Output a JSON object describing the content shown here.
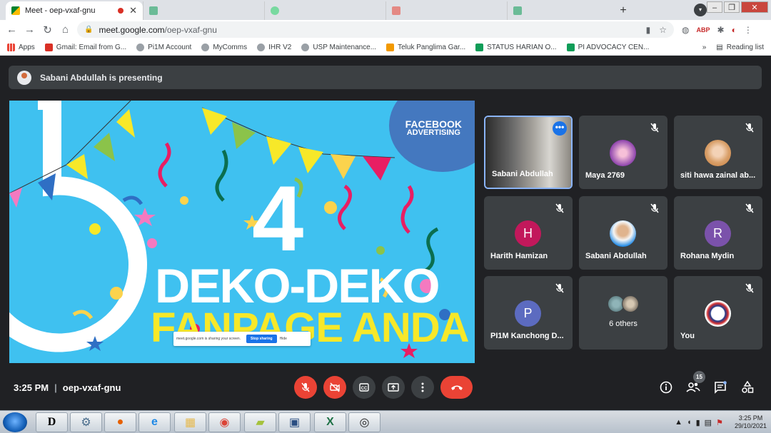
{
  "browser": {
    "tabs": [
      {
        "title": "Meet - oep-vxaf-gnu",
        "active": true
      },
      {
        "title": "",
        "active": false
      },
      {
        "title": "",
        "active": false
      },
      {
        "title": "",
        "active": false
      },
      {
        "title": "",
        "active": false
      }
    ],
    "url_host": "meet.google.com",
    "url_path": "/oep-vxaf-gnu",
    "bookmarks": [
      {
        "label": "Apps",
        "color": "#ea4335"
      },
      {
        "label": "Gmail: Email from G...",
        "color": "#d93025"
      },
      {
        "label": "Pi1M Account",
        "color": "#5f6368"
      },
      {
        "label": "MyComms",
        "color": "#5f6368"
      },
      {
        "label": "IHR V2",
        "color": "#5f6368"
      },
      {
        "label": "USP Maintenance...",
        "color": "#5f6368"
      },
      {
        "label": "Teluk Panglima Gar...",
        "color": "#f29900"
      },
      {
        "label": "STATUS HARIAN O...",
        "color": "#0f9d58"
      },
      {
        "label": "PI ADVOCACY CEN...",
        "color": "#0f9d58"
      }
    ],
    "reading_list": "Reading list"
  },
  "meet": {
    "presenter_text": "Sabani Abdullah is presenting",
    "slide": {
      "brand_line1": "FACEBOOK",
      "brand_line2": "ADVERTISING",
      "number": "4",
      "headline": "DEKO-DEKO",
      "subheadline": "FANPAGE ANDA",
      "share_text": "meet.google.com is sharing your screen.",
      "share_button": "Stop sharing",
      "share_hide": "Hide"
    },
    "participants": [
      {
        "name": "Sabani Abdullah",
        "type": "video"
      },
      {
        "name": "Maya 2769",
        "type": "photo",
        "color": "#c2579c"
      },
      {
        "name": "siti hawa zainal ab...",
        "type": "photo",
        "color": "#e8b07e"
      },
      {
        "name": "Harith Hamizan",
        "type": "letter",
        "letter": "H",
        "color": "#c2185b"
      },
      {
        "name": "Sabani Abdullah",
        "type": "photo",
        "color": "#f0f0f0"
      },
      {
        "name": "Rohana Mydin",
        "type": "letter",
        "letter": "R",
        "color": "#7b52ab"
      },
      {
        "name": "PI1M Kanchong D...",
        "type": "letter",
        "letter": "P",
        "color": "#5c6bc0"
      },
      {
        "name": "6 others",
        "type": "others"
      },
      {
        "name": "You",
        "type": "photo",
        "color": "#ffffff"
      }
    ],
    "time": "3:25 PM",
    "meeting_code": "oep-vxaf-gnu",
    "people_count": "15"
  },
  "taskbar": {
    "time": "3:25 PM",
    "date": "29/10/2021"
  }
}
